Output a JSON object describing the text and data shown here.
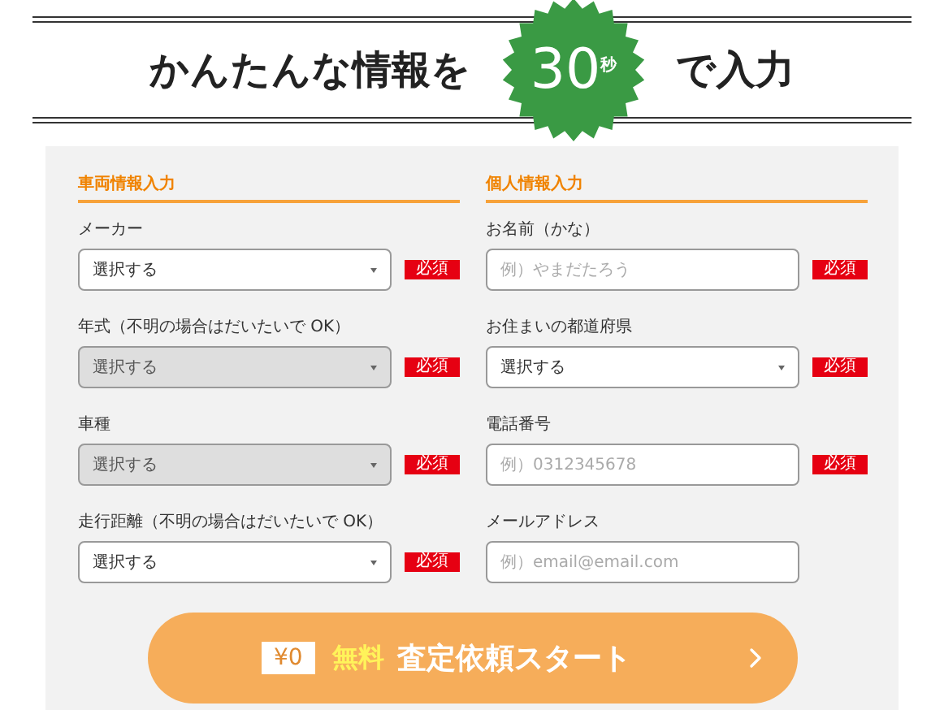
{
  "header": {
    "title_before": "かんたんな情報を",
    "badge_number": "30",
    "badge_unit": "秒",
    "title_after": "で入力"
  },
  "sections": [
    {
      "heading": "車両情報入力",
      "fields": [
        {
          "label": "メーカー",
          "kind": "select",
          "value": "選択する",
          "disabled": false,
          "required": "必須"
        },
        {
          "label": "年式（不明の場合はだいたいで OK）",
          "kind": "select",
          "value": "選択する",
          "disabled": true,
          "required": "必須"
        },
        {
          "label": "車種",
          "kind": "select",
          "value": "選択する",
          "disabled": true,
          "required": "必須"
        },
        {
          "label": "走行距離（不明の場合はだいたいで OK）",
          "kind": "select",
          "value": "選択する",
          "disabled": false,
          "required": "必須"
        }
      ]
    },
    {
      "heading": "個人情報入力",
      "fields": [
        {
          "label": "お名前（かな）",
          "kind": "text",
          "placeholder": "例）やまだたろう",
          "disabled": false,
          "required": "必須"
        },
        {
          "label": "お住まいの都道府県",
          "kind": "select",
          "value": "選択する",
          "disabled": false,
          "required": "必須"
        },
        {
          "label": "電話番号",
          "kind": "text",
          "placeholder": "例）0312345678",
          "disabled": false,
          "required": "必須"
        },
        {
          "label": "メールアドレス",
          "kind": "text",
          "placeholder": "例）email@email.com",
          "disabled": false
        }
      ]
    }
  ],
  "submit": {
    "price_tag": "¥0",
    "free": "無料",
    "label": "査定依頼スタート"
  }
}
